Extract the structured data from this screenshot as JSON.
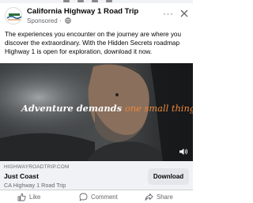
{
  "post": {
    "page_name": "California Highway 1 Road Trip",
    "sponsored": "Sponsored",
    "separator": "·",
    "more": "···",
    "body": "The experiences you encounter on the journey are where you discover the extraordinary. With the Hidden Secrets roadmap Highway 1 is open for exploration, download it now."
  },
  "media": {
    "overlay_main": "Adventure demands ",
    "overlay_accent": "one small thing"
  },
  "cta": {
    "domain": "HIGHWAYROADTRIP.COM",
    "headline": "Just Coast",
    "description": "CA Highway 1 Road Trip",
    "button": "Download"
  },
  "actions": {
    "like": "Like",
    "comment": "Comment",
    "share": "Share"
  },
  "colors": {
    "accent_text": "#f08a3c",
    "muted": "#65676b",
    "cta_bg": "#f0f2f5"
  },
  "icons": [
    "logo-icon",
    "globe-icon",
    "more-icon",
    "close-icon",
    "sound-icon",
    "like-icon",
    "comment-icon",
    "share-icon"
  ]
}
